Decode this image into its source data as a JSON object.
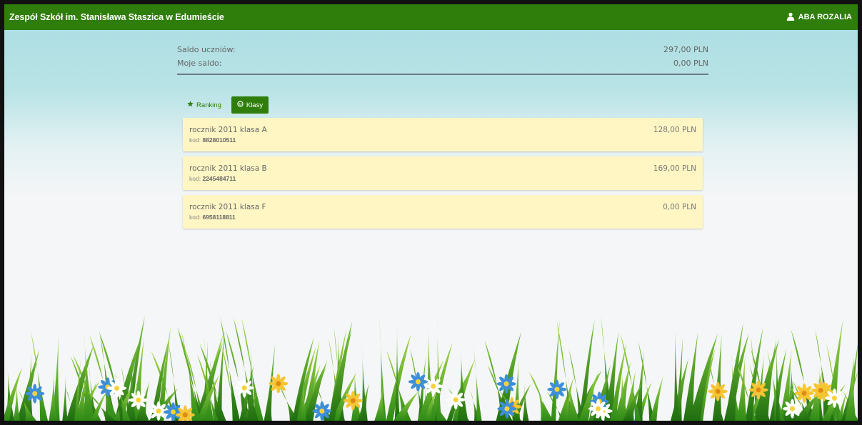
{
  "navbar": {
    "brand": "Zespół Szkół im. Stanisława Staszica w Edumieście",
    "user_name": "ABA ROZALIA",
    "user_icon": "user-icon",
    "color": "#2f7e0c"
  },
  "summary": {
    "students_label": "Saldo uczniów:",
    "students_value": "297,00 PLN",
    "mine_label": "Moje saldo:",
    "mine_value": "0,00 PLN"
  },
  "tabs": [
    {
      "label": "Ranking",
      "icon": "star-icon",
      "active": false
    },
    {
      "label": "Klasy",
      "icon": "circle-icon",
      "active": true
    }
  ],
  "classes": [
    {
      "name": "rocznik 2011 klasa A",
      "code_label": "kod:",
      "code": "8828010511",
      "amount": "128,00 PLN"
    },
    {
      "name": "rocznik 2011 klasa B",
      "code_label": "kod:",
      "code": "2245484711",
      "amount": "169,00 PLN"
    },
    {
      "name": "rocznik 2011 klasa F",
      "code_label": "kod:",
      "code": "6958118811",
      "amount": "0,00 PLN"
    }
  ],
  "card_color": "#fff6c4"
}
